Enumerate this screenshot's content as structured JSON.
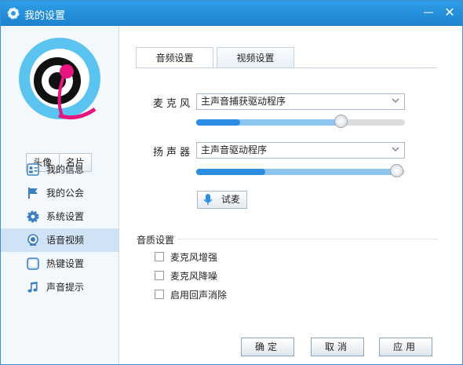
{
  "window": {
    "title": "我的设置",
    "minimize_glyph": "—",
    "close_glyph": "✕"
  },
  "sidebar": {
    "avatar_buttons": [
      "头像",
      "名片"
    ],
    "items": [
      {
        "label": "我的信息",
        "icon": "profile-card-icon",
        "active": false
      },
      {
        "label": "我的公会",
        "icon": "flag-icon",
        "active": false
      },
      {
        "label": "系统设置",
        "icon": "gear-icon",
        "active": false
      },
      {
        "label": "语音视频",
        "icon": "webcam-icon",
        "active": true
      },
      {
        "label": "热键设置",
        "icon": "keyboard-key-icon",
        "active": false
      },
      {
        "label": "声音提示",
        "icon": "music-note-icon",
        "active": false
      }
    ]
  },
  "tabs": [
    {
      "label": "音频设置",
      "active": true
    },
    {
      "label": "视频设置",
      "active": false
    }
  ],
  "audio": {
    "microphone": {
      "label": "麦克风",
      "selected": "主声音捕获驱动程序",
      "volume_fraction": 0.69,
      "level_fraction": 0.21
    },
    "speaker": {
      "label": "扬声器",
      "selected": "主声音驱动程序",
      "volume_fraction": 0.99,
      "level_fraction": 0.33
    },
    "test_button": "试麦"
  },
  "quality": {
    "title": "音质设置",
    "options": [
      {
        "label": "麦克风增强",
        "checked": false
      },
      {
        "label": "麦克风降噪",
        "checked": false
      },
      {
        "label": "启用回声消除",
        "checked": false
      }
    ]
  },
  "footer": {
    "ok": "确定",
    "cancel": "取消",
    "apply": "应用"
  },
  "colors": {
    "titlebar": "#1b82cf",
    "accent": "#2b8ee2",
    "selected_nav": "#cfe3f5"
  }
}
